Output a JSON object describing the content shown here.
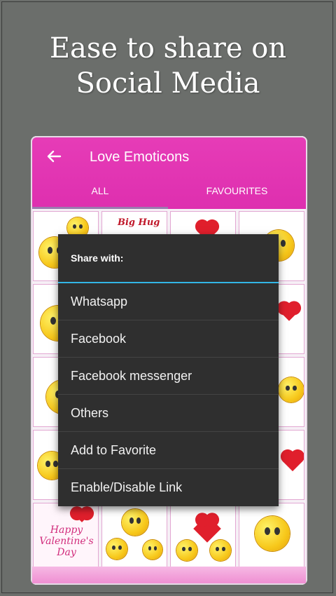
{
  "promo": {
    "line1": "Ease to share on",
    "line2": "Social Media"
  },
  "appbar": {
    "title": "Love Emoticons",
    "back_icon": "arrow-left-icon",
    "color": "#e33bb5"
  },
  "tabs": [
    {
      "label": "ALL",
      "selected": true
    },
    {
      "label": "FAVOURITES",
      "selected": false
    }
  ],
  "grid_texts": {
    "cell1": "Big Hug",
    "cell_valentine": "Happy Valentine's Day"
  },
  "share_dialog": {
    "title": "Share with:",
    "items": [
      "Whatsapp",
      "Facebook",
      "Facebook messenger",
      "Others",
      "Add to Favorite",
      "Enable/Disable Link"
    ],
    "accent": "#33b5e5",
    "background": "#2f2f2f"
  }
}
